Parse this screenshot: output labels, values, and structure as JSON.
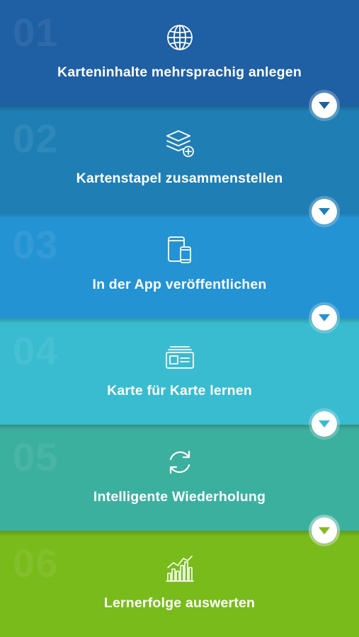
{
  "steps": [
    {
      "number": "01",
      "title": "Karteninhalte mehrsprachig anlegen",
      "icon": "globe-icon",
      "color": "#1f5fa3",
      "arrow_color": "#1f5fa3"
    },
    {
      "number": "02",
      "title": "Kartenstapel zusammenstellen",
      "icon": "stack-add-icon",
      "color": "#1f7fb5",
      "arrow_color": "#1f7fb5"
    },
    {
      "number": "03",
      "title": "In der App veröffentlichen",
      "icon": "devices-icon",
      "color": "#2493d3",
      "arrow_color": "#2493d3"
    },
    {
      "number": "04",
      "title": "Karte für Karte lernen",
      "icon": "cards-icon",
      "color": "#39bcd0",
      "arrow_color": "#39bcd0"
    },
    {
      "number": "05",
      "title": "Intelligente Wiederholung",
      "icon": "refresh-icon",
      "color": "#3cb09f",
      "arrow_color": "#3cb09f"
    },
    {
      "number": "06",
      "title": "Lernerfolge auswerten",
      "icon": "chart-icon",
      "color": "#78bb1b",
      "arrow_color": "#8ab61f"
    }
  ]
}
